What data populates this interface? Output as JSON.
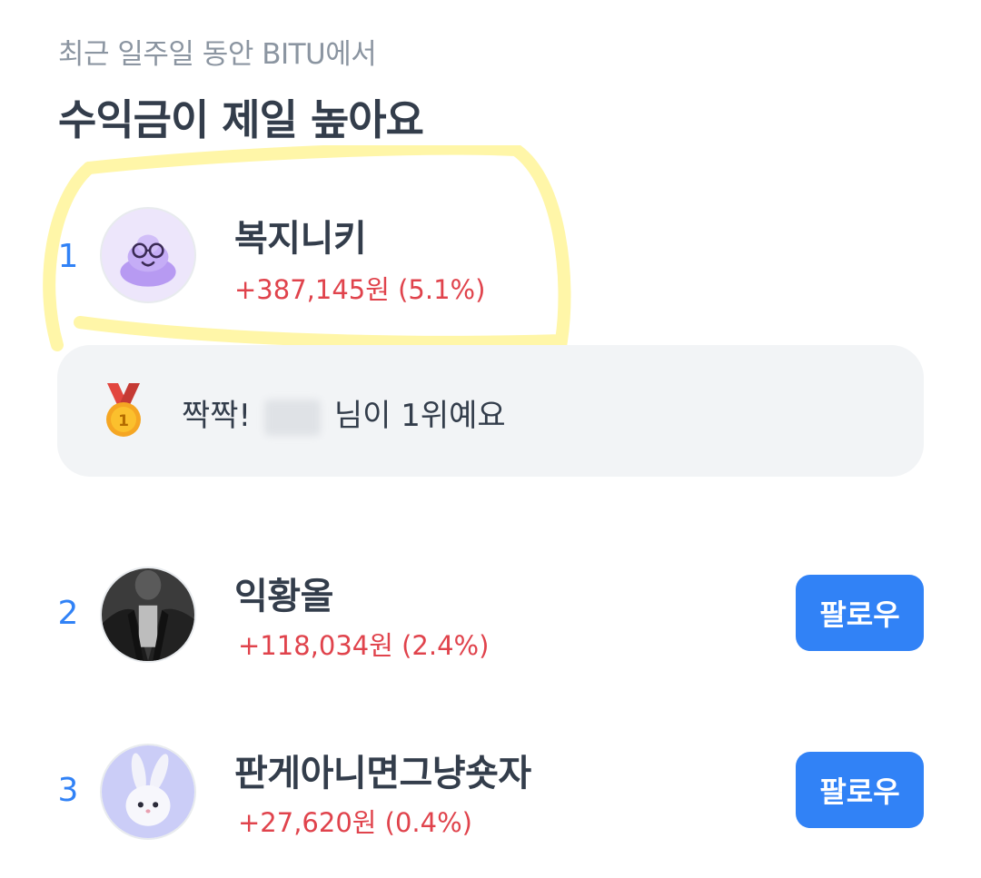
{
  "header": {
    "subtitle": "최근 일주일 동안 BITU에서",
    "title": "수익금이 제일 높아요"
  },
  "ranking": [
    {
      "rank": "1",
      "name": "복지니키",
      "profit": "+387,145원 (5.1%)",
      "avatar": "purple-blob-avatar"
    },
    {
      "rank": "2",
      "name": "익황올",
      "profit": "+118,034원 (2.4%)",
      "avatar": "photo-avatar",
      "follow_label": "팔로우"
    },
    {
      "rank": "3",
      "name": "판게아니면그냥숏자",
      "profit": "+27,620원 (0.4%)",
      "avatar": "bunny-avatar",
      "follow_label": "팔로우"
    }
  ],
  "congrats": {
    "prefix": "짝짝!",
    "suffix": "님이 1위예요",
    "icon": "gold-medal-icon"
  },
  "colors": {
    "accent": "#3182f6",
    "profit": "#e0434c",
    "highlight": "#fff6a8"
  }
}
